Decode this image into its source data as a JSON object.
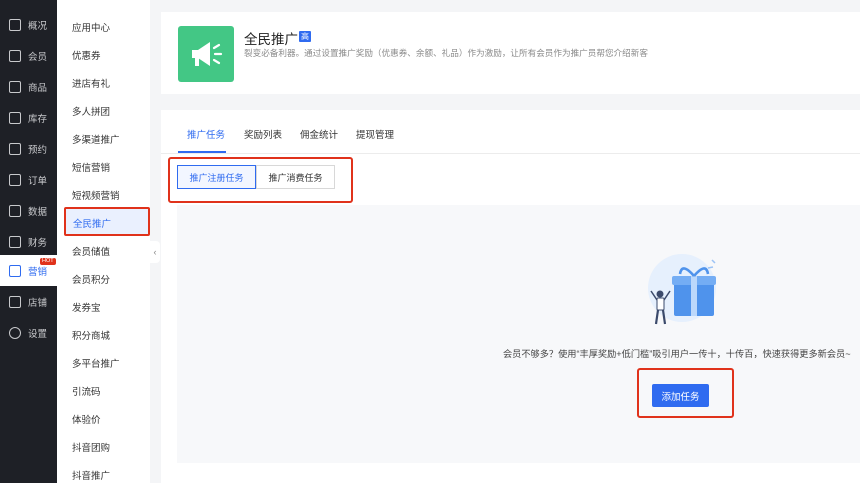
{
  "nav": {
    "items": [
      {
        "label": "概况",
        "icon": "grid-icon"
      },
      {
        "label": "会员",
        "icon": "crown-icon"
      },
      {
        "label": "商品",
        "icon": "store-icon"
      },
      {
        "label": "库存",
        "icon": "box-icon"
      },
      {
        "label": "预约",
        "icon": "calendar-check-icon"
      },
      {
        "label": "订单",
        "icon": "order-icon"
      },
      {
        "label": "数据",
        "icon": "chart-icon"
      },
      {
        "label": "财务",
        "icon": "wallet-icon"
      },
      {
        "label": "营销",
        "icon": "marketing-icon",
        "badge": "HOT"
      },
      {
        "label": "店铺",
        "icon": "shop-icon"
      },
      {
        "label": "设置",
        "icon": "settings-icon"
      }
    ]
  },
  "submenu": {
    "items": [
      "应用中心",
      "优惠券",
      "进店有礼",
      "多人拼团",
      "多渠道推广",
      "短信营销",
      "短视频营销",
      "全民推广",
      "会员储值",
      "会员积分",
      "发券宝",
      "积分商城",
      "多平台推广",
      "引流码",
      "体验价",
      "抖音团购",
      "抖音推广"
    ],
    "active": "全民推广"
  },
  "header": {
    "title": "全民推广",
    "badge": "高",
    "desc": "裂变必备利器。通过设置推广奖励（优惠券、余额、礼品）作为激励，让所有会员作为推广员帮您介绍新客"
  },
  "tabs": [
    "推广任务",
    "奖励列表",
    "佣金统计",
    "提现管理"
  ],
  "segments": [
    "推广注册任务",
    "推广消费任务"
  ],
  "empty": {
    "text": "会员不够多？使用“丰厚奖励+低门槛”吸引用户一传十，十传百，快速获得更多新会员~",
    "button": "添加任务"
  },
  "colors": {
    "accent": "#2f6bf0",
    "highlight": "#e0321b",
    "nav_bg": "#1e2026",
    "app_icon": "#43c785"
  }
}
